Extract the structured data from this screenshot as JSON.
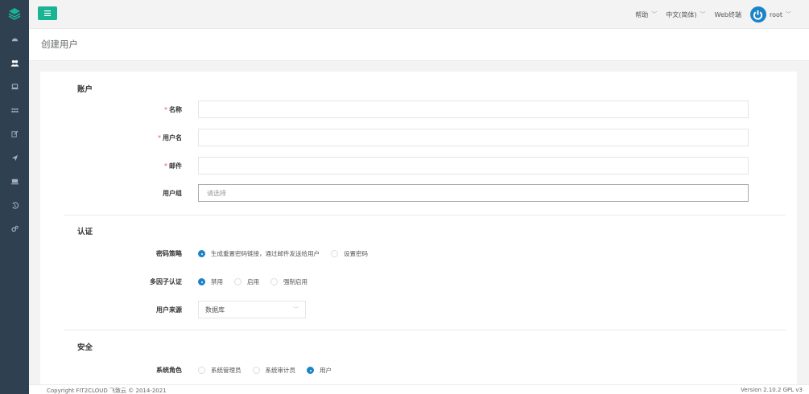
{
  "colors": {
    "accent": "#1ab394",
    "primary": "#1c84c6",
    "sidebar": "#2f4050",
    "required": "#ed5565"
  },
  "sidebar": {
    "logo_icon": "layers-icon",
    "items": [
      {
        "name": "dashboard-icon"
      },
      {
        "name": "users-icon",
        "active": true
      },
      {
        "name": "assets-icon"
      },
      {
        "name": "apps-grid-icon"
      },
      {
        "name": "edit-icon"
      },
      {
        "name": "send-icon"
      },
      {
        "name": "terminal-icon"
      },
      {
        "name": "history-icon"
      },
      {
        "name": "settings-icon"
      }
    ]
  },
  "topbar": {
    "help": "帮助",
    "language": "中文(简体)",
    "web_terminal": "Web终端",
    "username": "root"
  },
  "page": {
    "title": "创建用户"
  },
  "form": {
    "account_section": "账户",
    "name_label": "名称",
    "username_label": "用户名",
    "email_label": "邮件",
    "group_label": "用户组",
    "group_placeholder": "请选择",
    "auth_section": "认证",
    "password_strategy_label": "密码策略",
    "password_options": [
      "生成重置密码链接，通过邮件发送给用户",
      "设置密码"
    ],
    "mfa_label": "多因子认证",
    "mfa_options": [
      "禁用",
      "启用",
      "强制启用"
    ],
    "source_label": "用户来源",
    "source_value": "数据库",
    "security_section": "安全",
    "role_label": "系统角色",
    "role_options": [
      "系统管理员",
      "系统审计员",
      "用户"
    ]
  },
  "footer": {
    "left": "Copyright FIT2CLOUD 飞致云 © 2014-2021",
    "right": "Version 2.10.2 GPL v3"
  }
}
